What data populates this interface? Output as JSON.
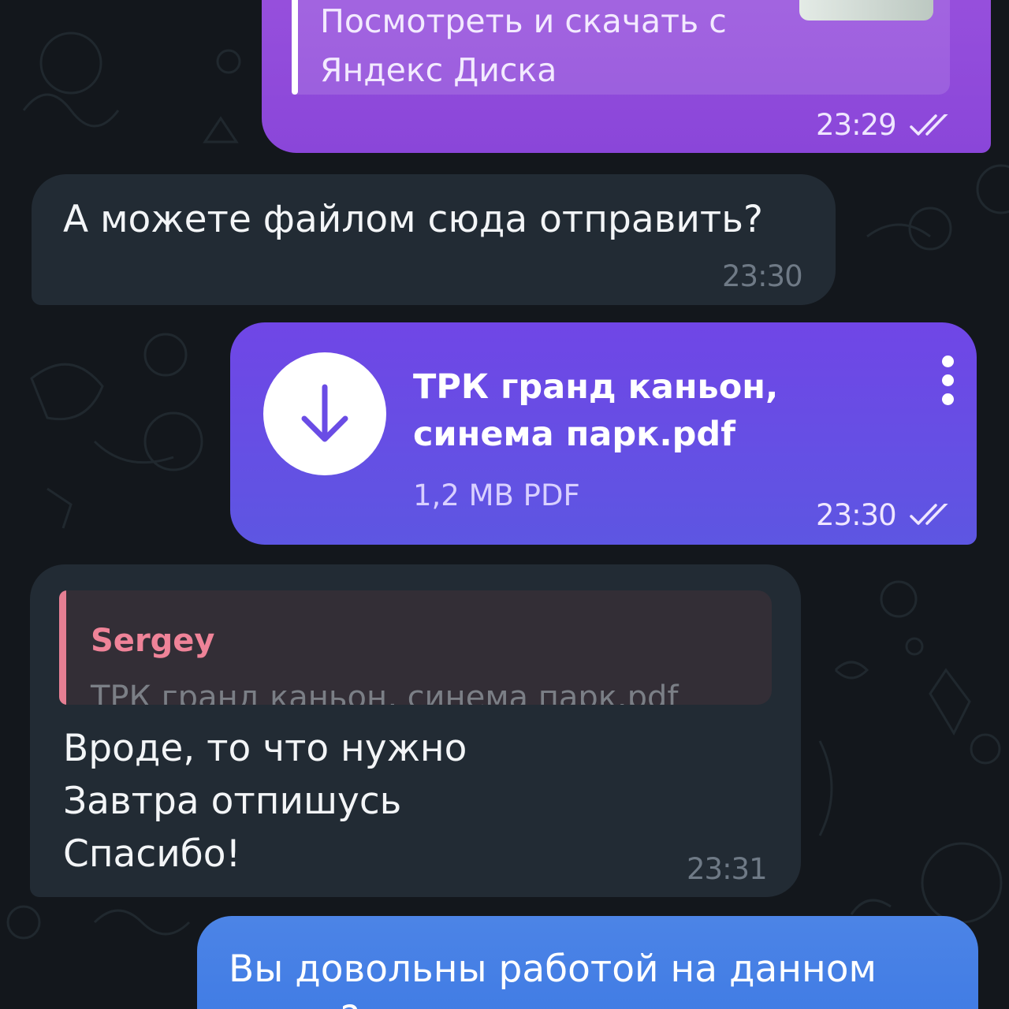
{
  "colors": {
    "background": "#13171c",
    "outgoing_purple": "#9a52dd",
    "outgoing_indigo": "#6a4ce5",
    "outgoing_blue": "#4c84e6",
    "incoming": "#222b34",
    "reply_accent": "#e57f93"
  },
  "messages": {
    "m1": {
      "link_text": "Посмотреть и скачать с Яндекс Диска",
      "time": "23:29",
      "status_icon": "double-check-icon"
    },
    "m2": {
      "text": "А можете файлом сюда отправить?",
      "time": "23:30"
    },
    "m3": {
      "file_name": "ТРК гранд каньон, синема парк.pdf",
      "file_meta": "1,2 MB PDF",
      "time": "23:30",
      "status_icon": "double-check-icon",
      "action_icon": "download-icon"
    },
    "m4": {
      "reply_author": "Sergey",
      "reply_text": "ТРК гранд каньон, синема парк.pdf",
      "lines": [
        "Вроде, то что нужно",
        "Завтра отпишусь",
        "Спасибо!"
      ],
      "time": "23:31"
    },
    "m5": {
      "text": "Вы довольны работой на данном этапе?"
    }
  }
}
